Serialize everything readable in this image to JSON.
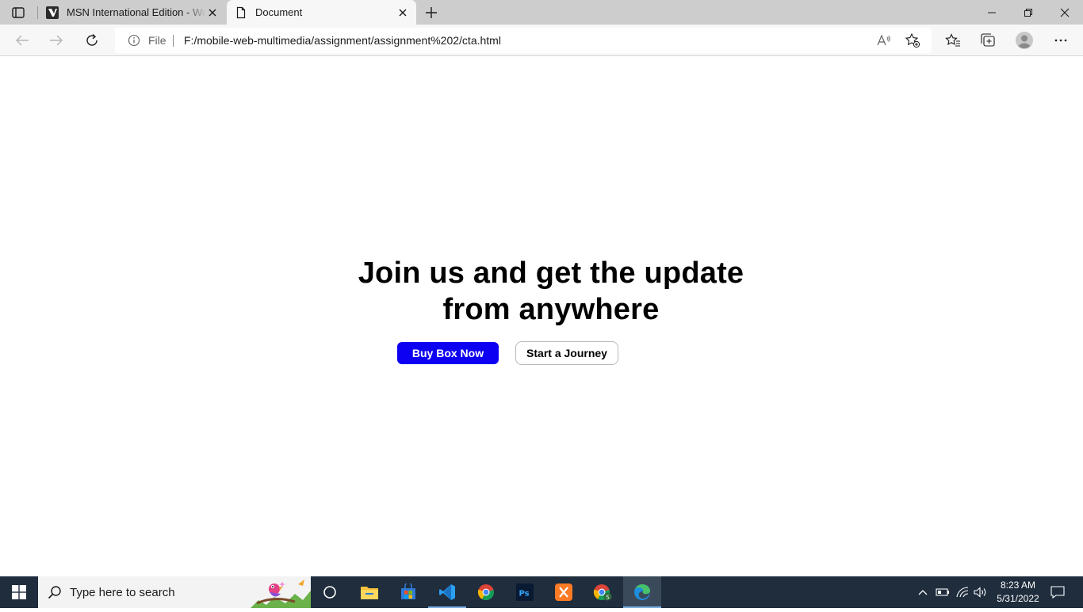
{
  "browser": {
    "tabs": [
      {
        "title": "MSN International Edition - World",
        "active": false,
        "icon": "msn-favicon-icon"
      },
      {
        "title": "Document",
        "active": true,
        "icon": "document-favicon-icon"
      }
    ],
    "address_bar": {
      "scheme_label": "File",
      "url": "F:/mobile-web-multimedia/assignment/assignment%202/cta.html"
    },
    "accent_color": "#0d00f2"
  },
  "page": {
    "heading_line1": "Join us and get the update",
    "heading_line2": "from anywhere",
    "primary_button": "Buy Box Now",
    "secondary_button": "Start a Journey"
  },
  "taskbar": {
    "search_placeholder": "Type here to search",
    "apps": [
      "task-view-icon",
      "file-explorer-icon",
      "microsoft-store-icon",
      "vscode-icon",
      "chrome-icon",
      "photoshop-icon",
      "xampp-icon",
      "chrome-profile-icon",
      "edge-icon"
    ],
    "clock": {
      "time": "8:23 AM",
      "date": "5/31/2022"
    }
  }
}
